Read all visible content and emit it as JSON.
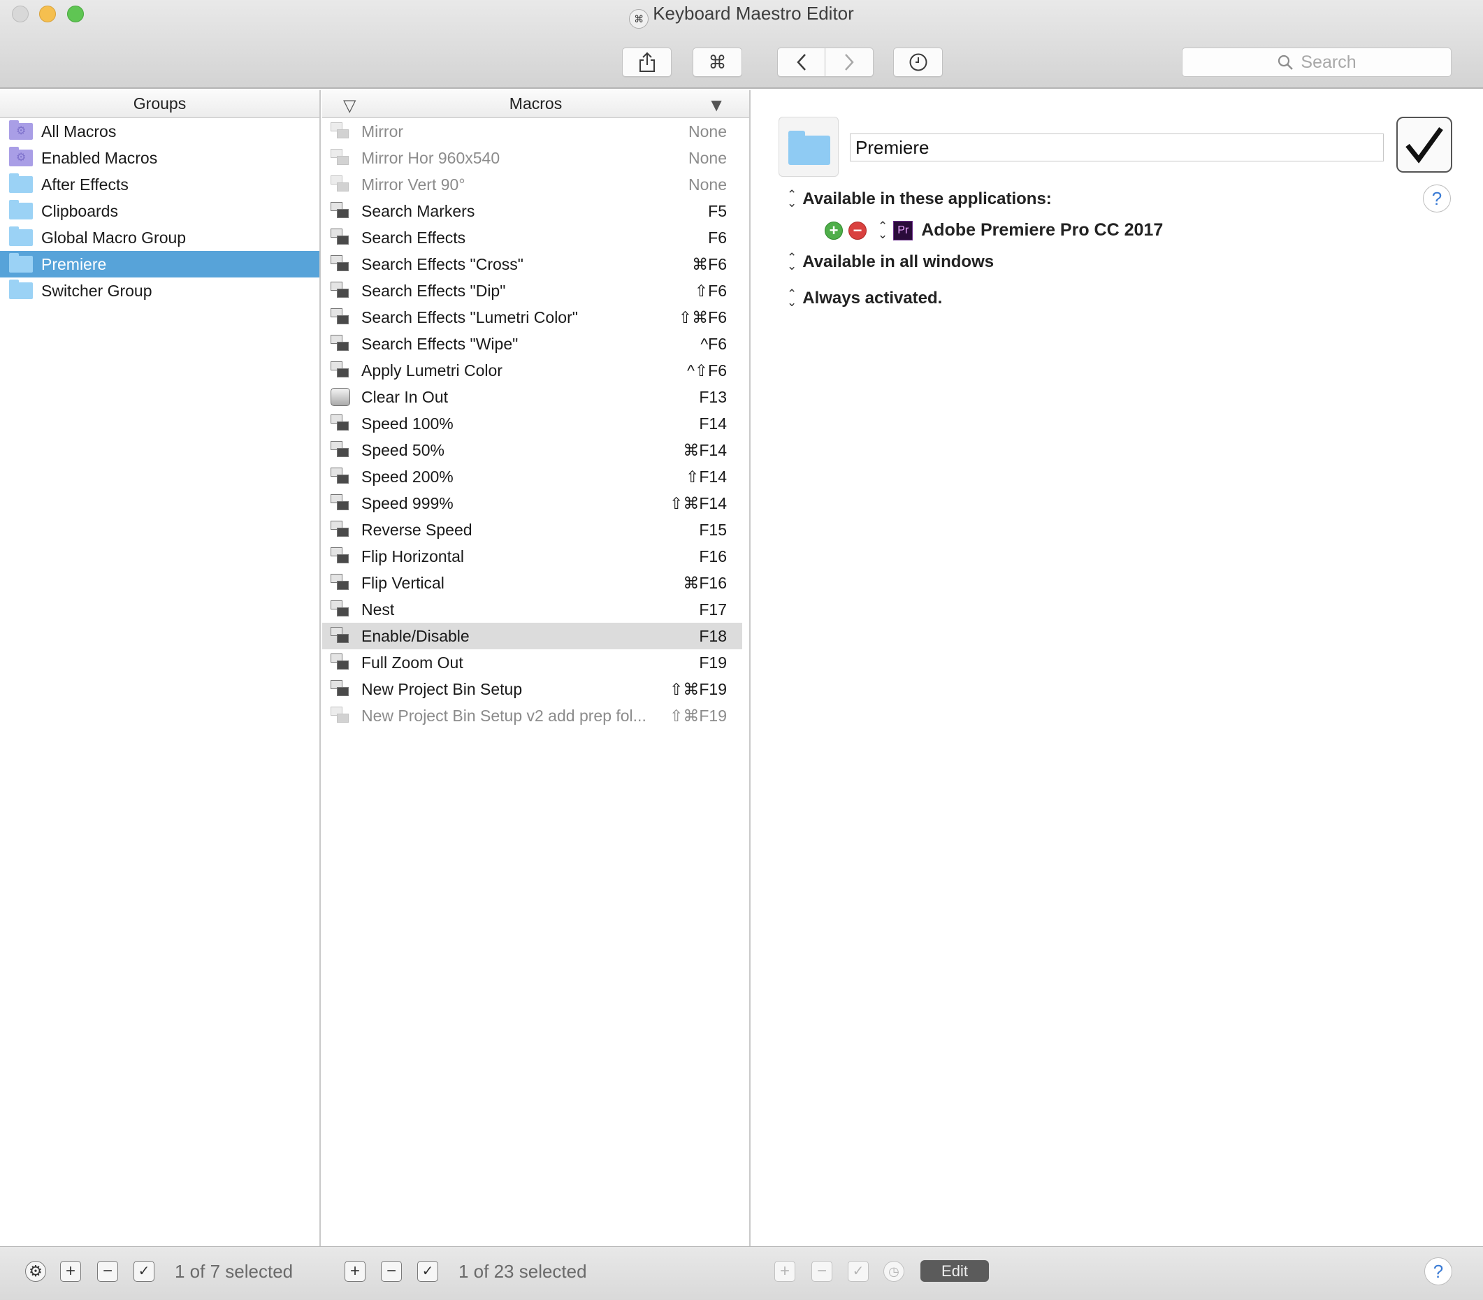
{
  "window": {
    "title": "Keyboard Maestro Editor",
    "app_icon_glyph": "⌘"
  },
  "toolbar": {
    "share_icon": "share-icon",
    "command_glyph": "⌘",
    "back_icon": "chevron-left-icon",
    "forward_icon": "chevron-right-icon",
    "history_icon": "clock-icon",
    "search_placeholder": "Search"
  },
  "groups": {
    "header": "Groups",
    "items": [
      {
        "label": "All Macros",
        "icon": "smart-folder-icon",
        "selected": false
      },
      {
        "label": "Enabled Macros",
        "icon": "smart-folder-icon",
        "selected": false
      },
      {
        "label": "After Effects",
        "icon": "folder-icon",
        "selected": false
      },
      {
        "label": "Clipboards",
        "icon": "folder-icon",
        "selected": false
      },
      {
        "label": "Global Macro Group",
        "icon": "folder-icon",
        "selected": false
      },
      {
        "label": "Premiere",
        "icon": "folder-icon",
        "selected": true
      },
      {
        "label": "Switcher Group",
        "icon": "folder-icon",
        "selected": false
      }
    ],
    "status": "1 of 7 selected"
  },
  "macros": {
    "header": "Macros",
    "items": [
      {
        "name": "Mirror",
        "key": "None",
        "disabled": true
      },
      {
        "name": "Mirror Hor 960x540",
        "key": "None",
        "disabled": true
      },
      {
        "name": "Mirror Vert 90°",
        "key": "None",
        "disabled": true
      },
      {
        "name": "Search Markers",
        "key": "F5"
      },
      {
        "name": "Search Effects",
        "key": "F6"
      },
      {
        "name": "Search Effects \"Cross\"",
        "key": "⌘F6"
      },
      {
        "name": "Search Effects \"Dip\"",
        "key": "⇧F6"
      },
      {
        "name": "Search Effects \"Lumetri Color\"",
        "key": "⇧⌘F6"
      },
      {
        "name": "Search Effects \"Wipe\"",
        "key": "^F6"
      },
      {
        "name": "Apply Lumetri Color",
        "key": "^⇧F6"
      },
      {
        "name": "Clear In Out",
        "key": "F13",
        "keyboard_icon": true
      },
      {
        "name": "Speed 100%",
        "key": "F14"
      },
      {
        "name": "Speed 50%",
        "key": "⌘F14"
      },
      {
        "name": "Speed 200%",
        "key": "⇧F14"
      },
      {
        "name": "Speed 999%",
        "key": "⇧⌘F14"
      },
      {
        "name": "Reverse Speed",
        "key": "F15"
      },
      {
        "name": "Flip Horizontal",
        "key": "F16"
      },
      {
        "name": "Flip Vertical",
        "key": "⌘F16"
      },
      {
        "name": "Nest",
        "key": "F17"
      },
      {
        "name": "Enable/Disable",
        "key": "F18",
        "selected": true
      },
      {
        "name": "Full Zoom Out",
        "key": "F19"
      },
      {
        "name": "New Project Bin Setup",
        "key": "⇧⌘F19"
      },
      {
        "name": "New Project Bin Setup v2 add prep fol...",
        "key": "⇧⌘F19",
        "disabled": true
      }
    ],
    "status": "1 of 23 selected"
  },
  "detail": {
    "group_name": "Premiere",
    "available_apps_label": "Available in these applications:",
    "app_name": "Adobe Premiere Pro CC 2017",
    "app_icon_text": "Pr",
    "windows_label": "Available in all windows",
    "activation_label": "Always activated.",
    "help_glyph": "?",
    "edit_label": "Edit"
  },
  "colors": {
    "selection_blue": "#57a3d9",
    "selection_gray": "#dcdcdc",
    "folder_blue": "#9bd2f5",
    "smart_folder_purple": "#a99ee6"
  }
}
